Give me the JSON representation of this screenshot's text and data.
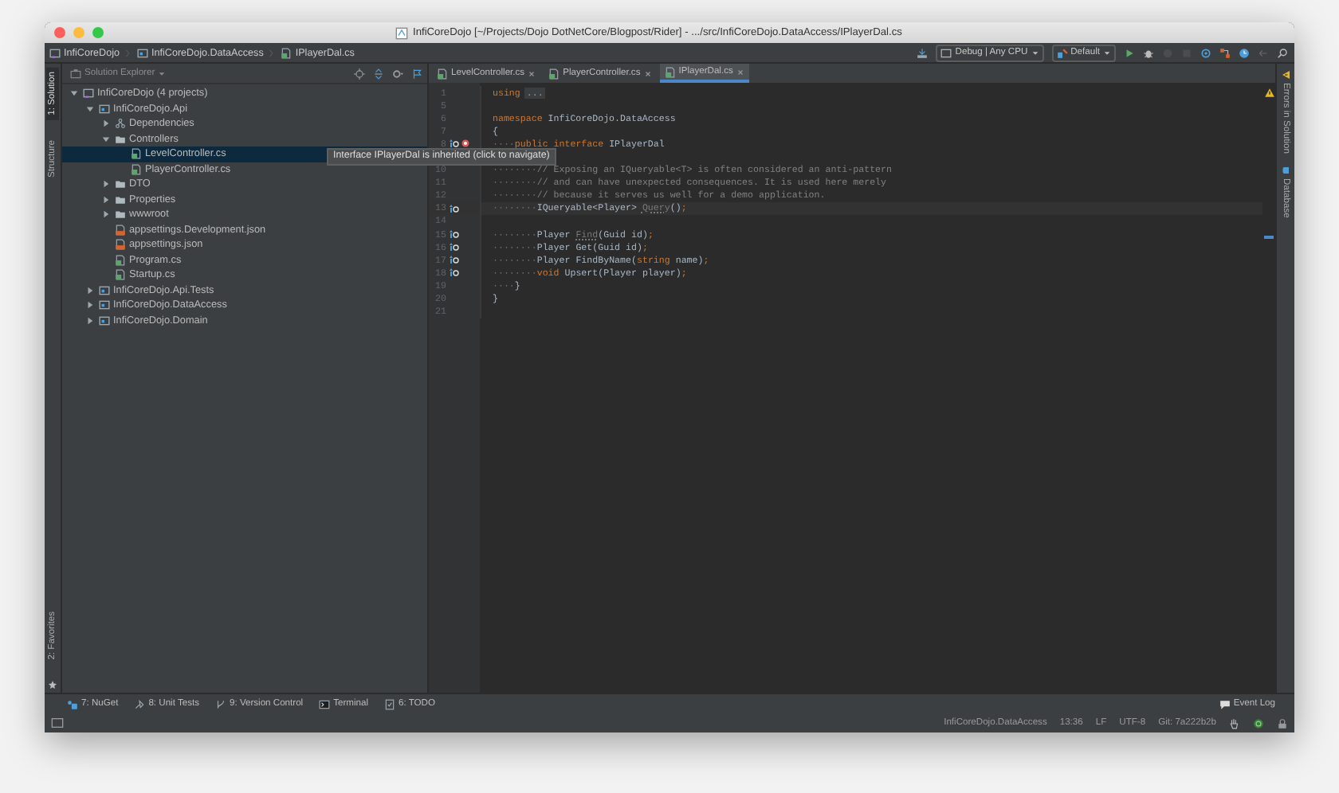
{
  "window": {
    "title": "InfiCoreDojo [~/Projects/Dojo DotNetCore/Blogpost/Rider] - .../src/InfiCoreDojo.DataAccess/IPlayerDal.cs"
  },
  "breadcrumbs": [
    {
      "label": "InfiCoreDojo",
      "kind": "solution"
    },
    {
      "label": "InfiCoreDojo.DataAccess",
      "kind": "project"
    },
    {
      "label": "IPlayerDal.cs",
      "kind": "cs"
    }
  ],
  "toolbar": {
    "configuration": "Debug | Any CPU",
    "profile": "Default"
  },
  "left_strip": {
    "top": [
      {
        "label": "1: Solution",
        "selected": true
      },
      {
        "label": "Structure",
        "selected": false
      }
    ],
    "bottom": [
      {
        "label": "2: Favorites",
        "selected": false
      }
    ]
  },
  "explorer": {
    "title": "Solution Explorer",
    "tree": [
      {
        "label": "InfiCoreDojo (4 projects)",
        "kind": "solution",
        "expanded": true,
        "selected": false,
        "children": [
          {
            "label": "InfiCoreDojo.Api",
            "kind": "project",
            "expanded": true,
            "selected": false,
            "children": [
              {
                "label": "Dependencies",
                "kind": "dependencies",
                "expanded": false,
                "selected": false
              },
              {
                "label": "Controllers",
                "kind": "folder",
                "expanded": true,
                "selected": false,
                "children": [
                  {
                    "label": "LevelController.cs",
                    "kind": "cs",
                    "selected": true
                  },
                  {
                    "label": "PlayerController.cs",
                    "kind": "cs",
                    "selected": false
                  }
                ]
              },
              {
                "label": "DTO",
                "kind": "folder",
                "expanded": false,
                "selected": false
              },
              {
                "label": "Properties",
                "kind": "folder",
                "expanded": false,
                "selected": false
              },
              {
                "label": "wwwroot",
                "kind": "folder",
                "expanded": false,
                "selected": false
              },
              {
                "label": "appsettings.Development.json",
                "kind": "json",
                "selected": false
              },
              {
                "label": "appsettings.json",
                "kind": "json",
                "selected": false
              },
              {
                "label": "Program.cs",
                "kind": "cs",
                "selected": false
              },
              {
                "label": "Startup.cs",
                "kind": "cs",
                "selected": false
              }
            ]
          },
          {
            "label": "InfiCoreDojo.Api.Tests",
            "kind": "project",
            "expanded": false,
            "selected": false
          },
          {
            "label": "InfiCoreDojo.DataAccess",
            "kind": "project",
            "expanded": false,
            "selected": false
          },
          {
            "label": "InfiCoreDojo.Domain",
            "kind": "project",
            "expanded": false,
            "selected": false
          }
        ]
      }
    ]
  },
  "editor": {
    "tabs": [
      {
        "label": "LevelController.cs",
        "selected": false
      },
      {
        "label": "PlayerController.cs",
        "selected": false
      },
      {
        "label": "IPlayerDal.cs",
        "selected": true
      }
    ],
    "lines": [
      {
        "number": "1",
        "kind": "code",
        "tokens": [
          {
            "kind": "keyword",
            "text": "using"
          },
          {
            "kind": "fold",
            "text": "..."
          }
        ]
      },
      {
        "number": "5",
        "kind": "code"
      },
      {
        "number": "6",
        "kind": "code",
        "tokens": [
          {
            "kind": "keyword",
            "text": "namespace"
          },
          {
            "kind": "plain",
            "text": " InfiCoreDojo.DataAccess"
          }
        ]
      },
      {
        "number": "7",
        "kind": "code",
        "tokens": [
          {
            "kind": "plain",
            "text": "{"
          }
        ]
      },
      {
        "number": "8",
        "kind": "navigable",
        "tooltip": "Interface IPlayerDal is inherited (click to navigate)",
        "tokens": [
          {
            "kind": "space",
            "text": "····"
          },
          {
            "kind": "keyword",
            "text": "public interface"
          },
          {
            "kind": "plain",
            "text": " IPlayerDal"
          }
        ]
      },
      {
        "number": "10",
        "kind": "code",
        "tokens": [
          {
            "kind": "space",
            "text": "········"
          },
          {
            "kind": "comment",
            "text": "// Exposing an IQueryable<T> is often considered an anti-pattern"
          }
        ]
      },
      {
        "number": "11",
        "kind": "code",
        "tokens": [
          {
            "kind": "space",
            "text": "········"
          },
          {
            "kind": "comment",
            "text": "// and can have unexpected consequences. It is used here merely"
          }
        ]
      },
      {
        "number": "12",
        "kind": "code",
        "tokens": [
          {
            "kind": "space",
            "text": "········"
          },
          {
            "kind": "comment",
            "text": "// because it serves us well for a demo application."
          }
        ]
      },
      {
        "number": "13",
        "kind": "inherited",
        "current": true,
        "tokens": [
          {
            "kind": "space",
            "text": "········"
          },
          {
            "kind": "plain",
            "text": "IQueryable<Player> "
          },
          {
            "kind": "unused",
            "text": "Query"
          },
          {
            "kind": "plain",
            "text": "()"
          },
          {
            "kind": "keyword",
            "text": ";"
          }
        ]
      },
      {
        "number": "14",
        "kind": "code"
      },
      {
        "number": "15",
        "kind": "inherited",
        "tokens": [
          {
            "kind": "space",
            "text": "········"
          },
          {
            "kind": "plain",
            "text": "Player "
          },
          {
            "kind": "unused",
            "text": "Find"
          },
          {
            "kind": "plain",
            "text": "(Guid id)"
          },
          {
            "kind": "keyword",
            "text": ";"
          }
        ]
      },
      {
        "number": "16",
        "kind": "inherited",
        "tokens": [
          {
            "kind": "space",
            "text": "········"
          },
          {
            "kind": "plain",
            "text": "Player "
          },
          {
            "kind": "method",
            "text": "Get"
          },
          {
            "kind": "plain",
            "text": "(Guid id)"
          },
          {
            "kind": "keyword",
            "text": ";"
          }
        ]
      },
      {
        "number": "17",
        "kind": "inherited",
        "tokens": [
          {
            "kind": "space",
            "text": "········"
          },
          {
            "kind": "plain",
            "text": "Player "
          },
          {
            "kind": "method",
            "text": "FindByName"
          },
          {
            "kind": "plain",
            "text": "("
          },
          {
            "kind": "keyword",
            "text": "string"
          },
          {
            "kind": "plain",
            "text": " name)"
          },
          {
            "kind": "keyword",
            "text": ";"
          }
        ]
      },
      {
        "number": "18",
        "kind": "inherited",
        "tokens": [
          {
            "kind": "space",
            "text": "········"
          },
          {
            "kind": "keyword",
            "text": "void"
          },
          {
            "kind": "method",
            "text": " Upsert"
          },
          {
            "kind": "plain",
            "text": "(Player player)"
          },
          {
            "kind": "keyword",
            "text": ";"
          }
        ]
      },
      {
        "number": "19",
        "kind": "code",
        "tokens": [
          {
            "kind": "space",
            "text": "····"
          },
          {
            "kind": "plain",
            "text": "}"
          }
        ]
      },
      {
        "number": "20",
        "kind": "code",
        "tokens": [
          {
            "kind": "plain",
            "text": "}"
          }
        ]
      },
      {
        "number": "21",
        "kind": "code"
      }
    ]
  },
  "right_strip": [
    {
      "label": "Errors in Solution",
      "kind": "errors"
    },
    {
      "label": "Database",
      "kind": "database"
    }
  ],
  "tool_tabs": [
    {
      "label": "7: NuGet",
      "kind": "nuget"
    },
    {
      "label": "8: Unit Tests",
      "kind": "tests"
    },
    {
      "label": "9: Version Control",
      "kind": "vcs"
    },
    {
      "label": "Terminal",
      "kind": "terminal"
    },
    {
      "label": "6: TODO",
      "kind": "todo"
    }
  ],
  "event_log": "Event Log",
  "status_bar": {
    "project": "InfiCoreDojo.DataAccess",
    "position": "13:36",
    "line_ending": "LF",
    "encoding": "UTF-8",
    "git": "Git: 7a222b2b"
  }
}
